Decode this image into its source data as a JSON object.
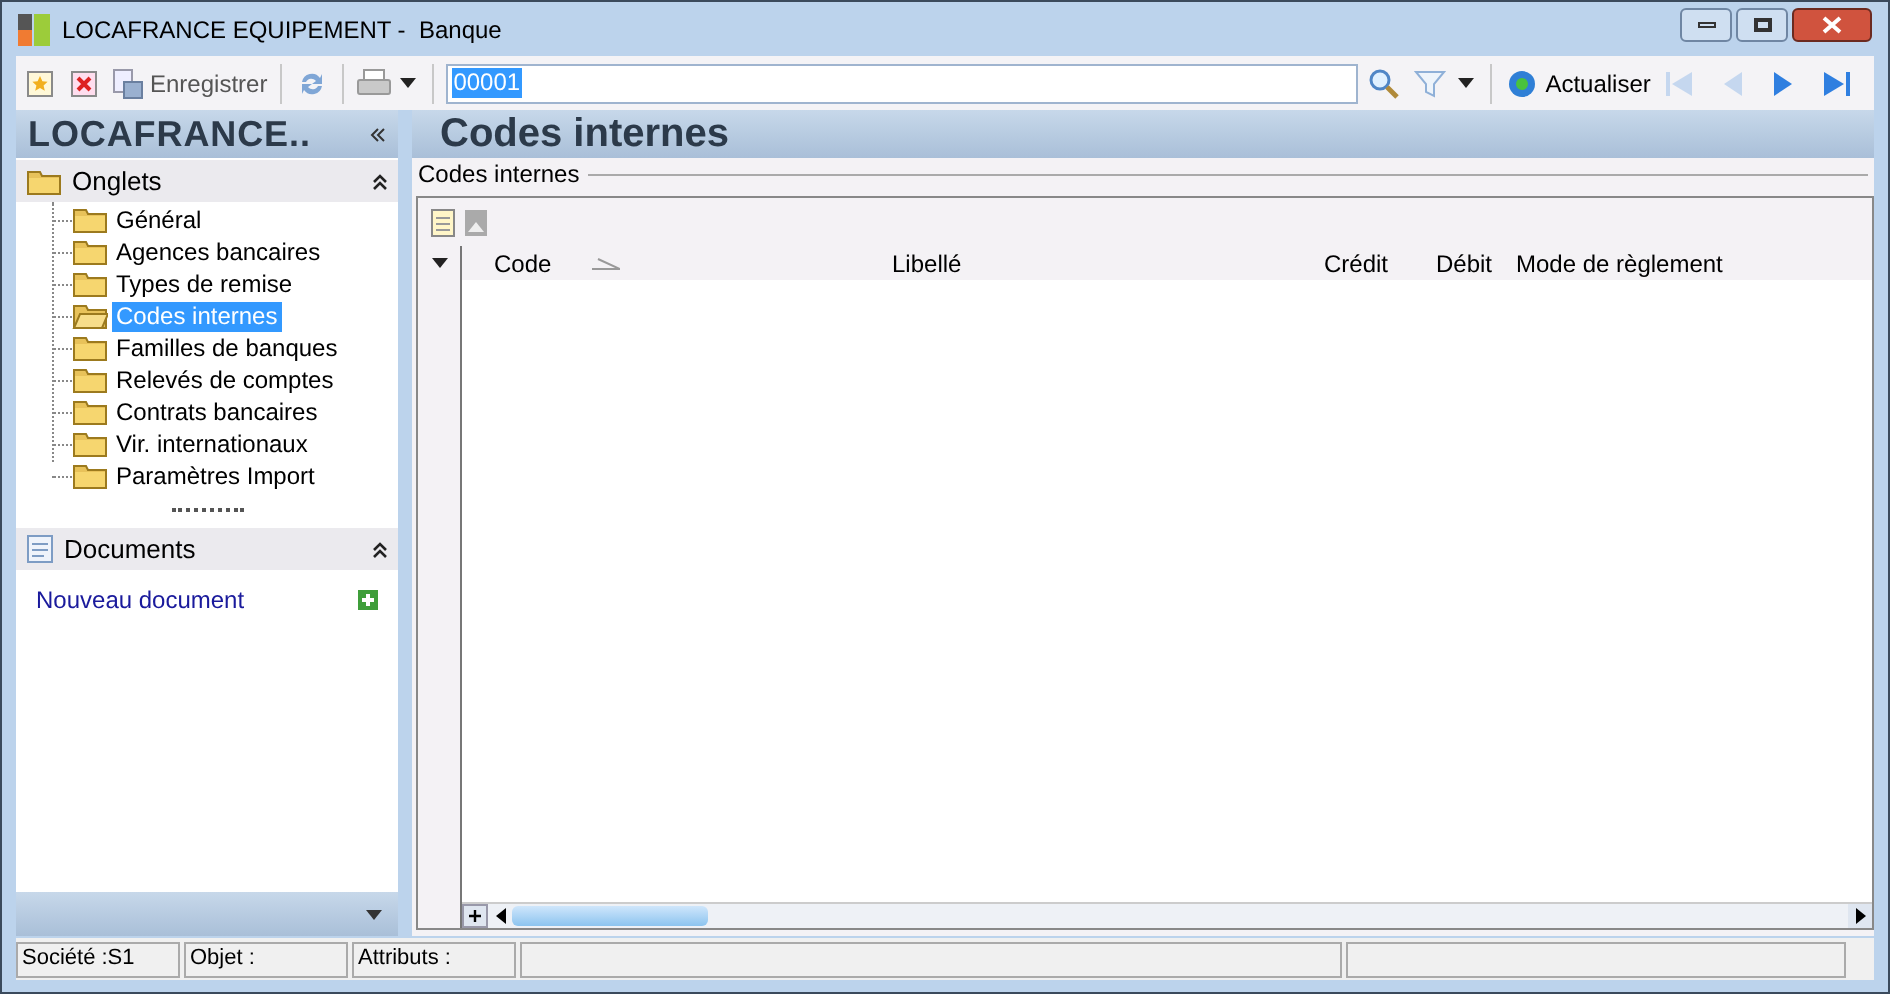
{
  "window": {
    "title": "LOCAFRANCE EQUIPEMENT -  Banque"
  },
  "toolbar": {
    "save_label": "Enregistrer",
    "search_value": "00001",
    "refresh_label": "Actualiser",
    "nav": [
      {
        "kind": "first",
        "disabled": true
      },
      {
        "kind": "prev",
        "disabled": true
      },
      {
        "kind": "next",
        "disabled": false
      },
      {
        "kind": "last",
        "disabled": false
      }
    ]
  },
  "sidebar": {
    "title": "LOCAFRANCE..",
    "tabs_title": "Onglets",
    "items": [
      {
        "label": "Général",
        "selected": false
      },
      {
        "label": "Agences bancaires",
        "selected": false
      },
      {
        "label": "Types de remise",
        "selected": false
      },
      {
        "label": "Codes internes",
        "selected": true
      },
      {
        "label": "Familles de banques",
        "selected": false
      },
      {
        "label": "Relevés de comptes",
        "selected": false
      },
      {
        "label": "Contrats bancaires",
        "selected": false
      },
      {
        "label": "Vir. internationaux",
        "selected": false
      },
      {
        "label": "Paramètres Import",
        "selected": false
      }
    ],
    "documents_title": "Documents",
    "new_document": "Nouveau document"
  },
  "content": {
    "title": "Codes internes",
    "group_label": "Codes internes",
    "table": {
      "columns": [
        {
          "label": "Code",
          "sorted": true
        },
        {
          "label": "Libellé",
          "sorted": false
        },
        {
          "label": "Crédit",
          "sorted": false
        },
        {
          "label": "Débit",
          "sorted": false
        },
        {
          "label": "Mode de règlement",
          "sorted": false
        }
      ]
    }
  },
  "status_bar": [
    "Société :S1",
    "Objet :",
    "Attributs :"
  ]
}
